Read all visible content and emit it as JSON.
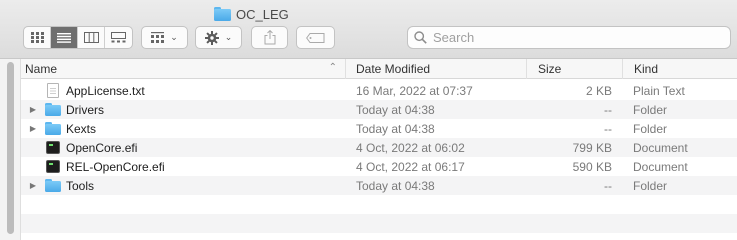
{
  "window": {
    "title": "OC_LEG"
  },
  "toolbar": {
    "view_modes": [
      "icon-view",
      "list-view",
      "column-view",
      "gallery-view"
    ],
    "active_view": "list-view",
    "group_button": "group-by-menu",
    "action_button": "action-gear-menu",
    "share_button": "share",
    "tag_button": "tags",
    "search_placeholder": "Search"
  },
  "columns": {
    "name": "Name",
    "date": "Date Modified",
    "size": "Size",
    "kind": "Kind"
  },
  "files": [
    {
      "name": "AppLicense.txt",
      "date": "16 Mar, 2022 at 07:37",
      "size": "2 KB",
      "kind": "Plain Text",
      "icon": "text-document-icon",
      "expandable": false
    },
    {
      "name": "Drivers",
      "date": "Today at 04:38",
      "size": "--",
      "kind": "Folder",
      "icon": "folder-icon",
      "expandable": true
    },
    {
      "name": "Kexts",
      "date": "Today at 04:38",
      "size": "--",
      "kind": "Folder",
      "icon": "folder-icon",
      "expandable": true
    },
    {
      "name": "OpenCore.efi",
      "date": "4 Oct, 2022 at 06:02",
      "size": "799 KB",
      "kind": "Document",
      "icon": "executable-icon",
      "expandable": false
    },
    {
      "name": "REL-OpenCore.efi",
      "date": "4 Oct, 2022 at 06:17",
      "size": "590 KB",
      "kind": "Document",
      "icon": "executable-icon",
      "expandable": false
    },
    {
      "name": "Tools",
      "date": "Today at 04:38",
      "size": "--",
      "kind": "Folder",
      "icon": "folder-icon",
      "expandable": true
    }
  ]
}
